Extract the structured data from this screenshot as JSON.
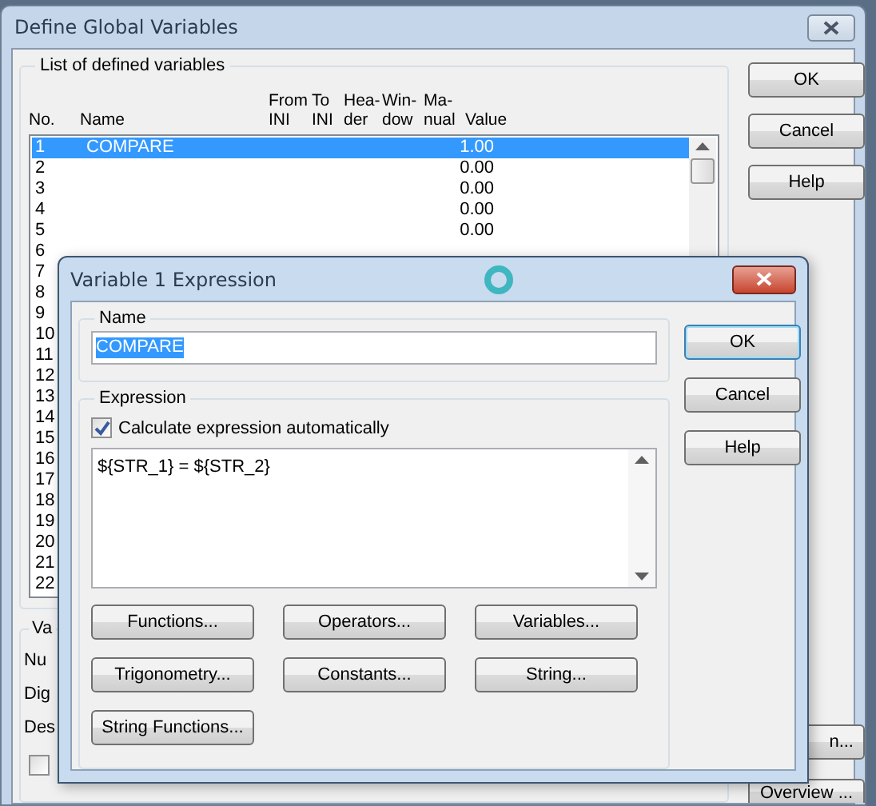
{
  "window": {
    "title": "Define Global Variables"
  },
  "variables_group": {
    "title": "List of defined variables",
    "columns": [
      {
        "bottom": "No."
      },
      {
        "bottom": "Name"
      },
      {
        "top": "From",
        "bottom": "INI"
      },
      {
        "top": "To",
        "bottom": "INI"
      },
      {
        "top": "Hea-",
        "bottom": "der"
      },
      {
        "top": "Win-",
        "bottom": "dow"
      },
      {
        "top": "Ma-",
        "bottom": "nual"
      },
      {
        "bottom": "Value"
      }
    ],
    "rows": [
      {
        "no": "1",
        "name": "COMPARE",
        "value": "1.00",
        "selected": true
      },
      {
        "no": "2",
        "value": "0.00",
        "selected": false
      },
      {
        "no": "3",
        "value": "0.00",
        "selected": false
      },
      {
        "no": "4",
        "value": "0.00",
        "selected": false
      },
      {
        "no": "5",
        "value": "0.00",
        "selected": false
      },
      {
        "no": "6",
        "selected": false
      },
      {
        "no": "7",
        "selected": false
      },
      {
        "no": "8",
        "selected": false
      },
      {
        "no": "9",
        "selected": false
      },
      {
        "no": "10",
        "selected": false
      },
      {
        "no": "11",
        "selected": false
      },
      {
        "no": "12",
        "selected": false
      },
      {
        "no": "13",
        "selected": false
      },
      {
        "no": "14",
        "selected": false
      },
      {
        "no": "15",
        "selected": false
      },
      {
        "no": "16",
        "selected": false
      },
      {
        "no": "17",
        "selected": false
      },
      {
        "no": "18",
        "selected": false
      },
      {
        "no": "19",
        "selected": false
      },
      {
        "no": "20",
        "selected": false
      },
      {
        "no": "21",
        "selected": false
      },
      {
        "no": "22",
        "selected": false
      }
    ]
  },
  "buttons": [
    "OK",
    "Cancel",
    "Help"
  ],
  "values_group": {
    "title": "Va",
    "labels": [
      "Nu",
      "Dig",
      "Des"
    ],
    "checkbox": {
      "checked": false
    }
  },
  "side_buttons": [
    "n...",
    "Overview ..."
  ],
  "dialog": {
    "title": "Variable 1 Expression",
    "name_group": {
      "title": "Name",
      "value": "COMPARE",
      "value_selected": true
    },
    "expression_group": {
      "title": "Expression",
      "auto": {
        "label": "Calculate expression automatically",
        "checked": true
      },
      "expression": "${STR_1} = ${STR_2}",
      "buttons": [
        "Functions...",
        "Operators...",
        "Variables...",
        "Trigonometry...",
        "Constants...",
        "String...",
        "String Functions..."
      ]
    },
    "buttons": [
      {
        "label": "OK",
        "default": true
      },
      {
        "label": "Cancel",
        "default": false
      },
      {
        "label": "Help",
        "default": false
      }
    ]
  }
}
